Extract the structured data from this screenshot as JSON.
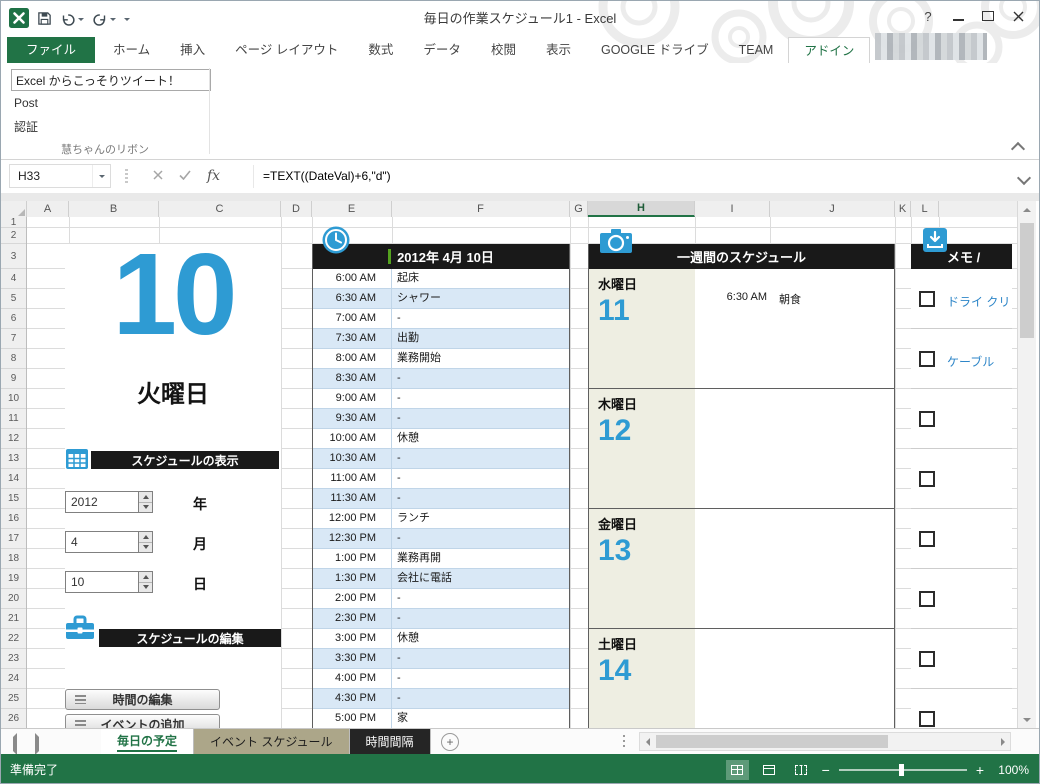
{
  "window": {
    "title": "毎日の作業スケジュール1 - Excel",
    "help_label": "?"
  },
  "ribbon": {
    "tabs": [
      {
        "label": "ファイル",
        "type": "file"
      },
      {
        "label": "ホーム"
      },
      {
        "label": "挿入"
      },
      {
        "label": "ページ レイアウト"
      },
      {
        "label": "数式"
      },
      {
        "label": "データ"
      },
      {
        "label": "校閲"
      },
      {
        "label": "表示"
      },
      {
        "label": "GOOGLE ドライブ"
      },
      {
        "label": "TEAM"
      },
      {
        "label": "アドイン",
        "type": "selected"
      }
    ],
    "addin": {
      "tweet_text": "Excel からこっそりツイート！",
      "post_label": "Post",
      "auth_label": "認証",
      "group_label": "慧ちゃんのリボン"
    }
  },
  "formula_bar": {
    "name_box": "H33",
    "fx_label": "fx",
    "formula": "=TEXT((DateVal)+6,\"d\")"
  },
  "grid": {
    "columns": [
      "A",
      "B",
      "C",
      "D",
      "E",
      "F",
      "G",
      "H",
      "I",
      "J",
      "K",
      "L"
    ],
    "selected_column": "H",
    "rows": [
      1,
      2,
      3,
      4,
      5,
      6,
      7,
      8,
      9,
      10,
      11,
      12,
      13,
      14,
      15,
      16,
      17,
      18,
      19,
      20,
      21,
      22,
      23,
      24,
      25,
      26
    ]
  },
  "sheet": {
    "day_number": "10",
    "day_name": "火曜日",
    "date_header": "2012年 4月 10日",
    "schedule": [
      {
        "time": "6:00 AM",
        "event": "起床"
      },
      {
        "time": "6:30 AM",
        "event": "シャワー"
      },
      {
        "time": "7:00 AM",
        "event": "-"
      },
      {
        "time": "7:30 AM",
        "event": "出勤"
      },
      {
        "time": "8:00 AM",
        "event": "業務開始"
      },
      {
        "time": "8:30 AM",
        "event": "-"
      },
      {
        "time": "9:00 AM",
        "event": "-"
      },
      {
        "time": "9:30 AM",
        "event": "-"
      },
      {
        "time": "10:00 AM",
        "event": "休憩"
      },
      {
        "time": "10:30 AM",
        "event": "-"
      },
      {
        "time": "11:00 AM",
        "event": "-"
      },
      {
        "time": "11:30 AM",
        "event": "-"
      },
      {
        "time": "12:00 PM",
        "event": "ランチ"
      },
      {
        "time": "12:30 PM",
        "event": "-"
      },
      {
        "time": "1:00 PM",
        "event": "業務再開"
      },
      {
        "time": "1:30 PM",
        "event": "会社に電話"
      },
      {
        "time": "2:00 PM",
        "event": "-"
      },
      {
        "time": "2:30 PM",
        "event": "-"
      },
      {
        "time": "3:00 PM",
        "event": "休憩"
      },
      {
        "time": "3:30 PM",
        "event": "-"
      },
      {
        "time": "4:00 PM",
        "event": "-"
      },
      {
        "time": "4:30 PM",
        "event": "-"
      },
      {
        "time": "5:00 PM",
        "event": "家"
      }
    ],
    "weekly": {
      "header": "一週間のスケジュール",
      "days": [
        {
          "name": "水曜日",
          "number": "11",
          "entries": [
            {
              "time": "6:30 AM",
              "event": "朝食"
            }
          ]
        },
        {
          "name": "木曜日",
          "number": "12",
          "entries": []
        },
        {
          "name": "金曜日",
          "number": "13",
          "entries": []
        },
        {
          "name": "土曜日",
          "number": "14",
          "entries": []
        }
      ]
    },
    "memo": {
      "header": "メモ /",
      "items": [
        "ドライ クリ",
        "ケーブル",
        "",
        "",
        "",
        "",
        "",
        ""
      ]
    },
    "controls": {
      "show_header": "スケジュールの表示",
      "year": {
        "value": "2012",
        "unit": "年"
      },
      "month": {
        "value": "4",
        "unit": "月"
      },
      "day": {
        "value": "10",
        "unit": "日"
      },
      "edit_header": "スケジュールの編集",
      "time_button": "時間の編集",
      "event_button": "イベントの追加"
    }
  },
  "tabs_bar": {
    "sheets": [
      {
        "label": "毎日の予定",
        "variant": "active"
      },
      {
        "label": "イベント スケジュール",
        "variant": "olive"
      },
      {
        "label": "時間間隔",
        "variant": "black"
      }
    ],
    "add_label": "+"
  },
  "status_bar": {
    "ready": "準備完了",
    "zoom_out": "−",
    "zoom_in": "+",
    "zoom_pct": "100%"
  },
  "colors": {
    "excel_green": "#217346",
    "accent_blue": "#2e9bd3",
    "alt_row_blue": "#d9e8f6",
    "weekly_day_bg": "#eeeee2",
    "header_black": "#191919"
  }
}
